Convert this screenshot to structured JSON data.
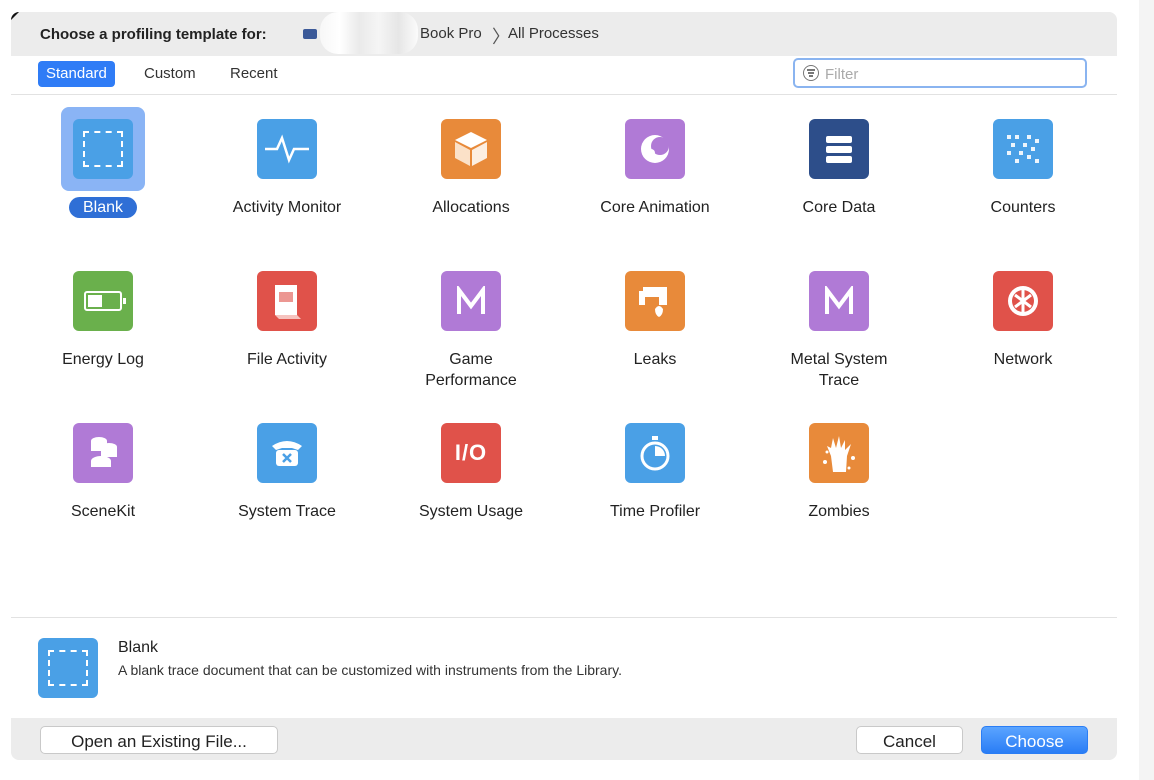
{
  "header": {
    "choose_label": "Choose a profiling template for:",
    "device_name": "Book Pro",
    "crumb_separator": "〉",
    "process": "All Processes"
  },
  "tabs": [
    {
      "label": "Standard",
      "active": true
    },
    {
      "label": "Custom",
      "active": false
    },
    {
      "label": "Recent",
      "active": false
    }
  ],
  "filter": {
    "placeholder": "Filter",
    "value": ""
  },
  "templates": [
    {
      "label": "Blank",
      "icon": "blank-icon",
      "color": "#4aa0e6",
      "selected": true
    },
    {
      "label": "Activity Monitor",
      "icon": "activity-monitor-icon",
      "color": "#4aa0e6"
    },
    {
      "label": "Allocations",
      "icon": "allocations-icon",
      "color": "#e88a3a"
    },
    {
      "label": "Core Animation",
      "icon": "core-animation-icon",
      "color": "#b07ad6"
    },
    {
      "label": "Core Data",
      "icon": "core-data-icon",
      "color": "#2d4e8a"
    },
    {
      "label": "Counters",
      "icon": "counters-icon",
      "color": "#4aa0e6"
    },
    {
      "label": "Energy Log",
      "icon": "energy-log-icon",
      "color": "#6ab04c"
    },
    {
      "label": "File Activity",
      "icon": "file-activity-icon",
      "color": "#e0524a"
    },
    {
      "label": "Game Performance",
      "icon": "game-performance-icon",
      "color": "#b07ad6"
    },
    {
      "label": "Leaks",
      "icon": "leaks-icon",
      "color": "#e88a3a"
    },
    {
      "label": "Metal System Trace",
      "icon": "metal-system-trace-icon",
      "color": "#b07ad6"
    },
    {
      "label": "Network",
      "icon": "network-icon",
      "color": "#e0524a"
    },
    {
      "label": "SceneKit",
      "icon": "scenekit-icon",
      "color": "#b07ad6"
    },
    {
      "label": "System Trace",
      "icon": "system-trace-icon",
      "color": "#4aa0e6"
    },
    {
      "label": "System Usage",
      "icon": "system-usage-icon",
      "color": "#e0524a",
      "glyph": "I/O"
    },
    {
      "label": "Time Profiler",
      "icon": "time-profiler-icon",
      "color": "#4aa0e6"
    },
    {
      "label": "Zombies",
      "icon": "zombies-icon",
      "color": "#e88a3a"
    }
  ],
  "info": {
    "title": "Blank",
    "description": "A blank trace document that can be customized with instruments from the Library."
  },
  "buttons": {
    "open_existing": "Open an Existing File...",
    "cancel": "Cancel",
    "choose": "Choose"
  }
}
